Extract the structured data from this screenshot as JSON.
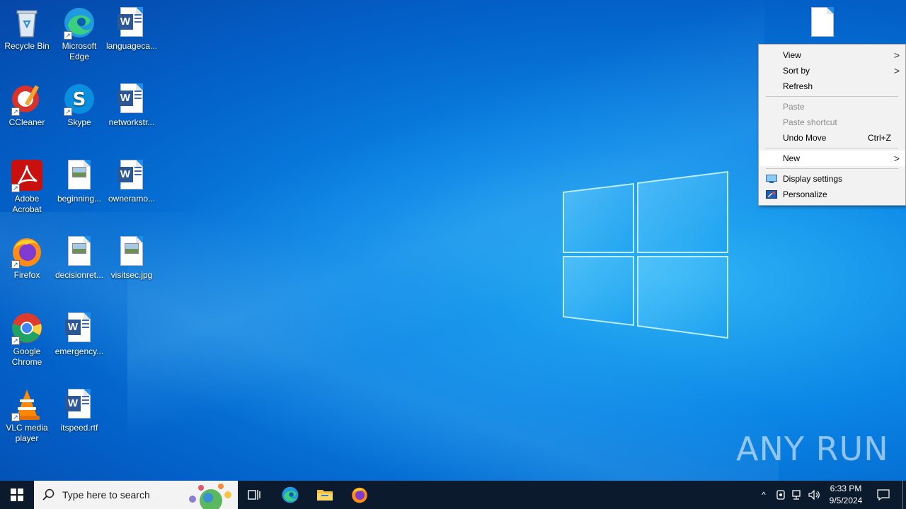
{
  "desktop": {
    "icons": [
      {
        "label": "Recycle Bin",
        "icon": "recycle-bin-icon"
      },
      {
        "label": "Microsoft Edge",
        "icon": "edge-icon"
      },
      {
        "label": "languageca...",
        "icon": "word-doc-icon"
      },
      {
        "label": "CCleaner",
        "icon": "ccleaner-icon"
      },
      {
        "label": "Skype",
        "icon": "skype-icon"
      },
      {
        "label": "networkstr...",
        "icon": "word-doc-icon"
      },
      {
        "label": "Adobe Acrobat",
        "icon": "acrobat-icon"
      },
      {
        "label": "beginning...",
        "icon": "image-file-icon"
      },
      {
        "label": "owneramo...",
        "icon": "word-doc-icon"
      },
      {
        "label": "Firefox",
        "icon": "firefox-icon"
      },
      {
        "label": "decisionret...",
        "icon": "image-file-icon"
      },
      {
        "label": "visitsec.jpg",
        "icon": "image-file-icon"
      },
      {
        "label": "Google Chrome",
        "icon": "chrome-icon"
      },
      {
        "label": "emergency...",
        "icon": "word-doc-icon"
      },
      {
        "label": "VLC media player",
        "icon": "vlc-icon"
      },
      {
        "label": "itspeed.rtf",
        "icon": "word-doc-icon"
      },
      {
        "label": "",
        "icon": "blank-file-icon"
      }
    ]
  },
  "context_menu": {
    "items": [
      {
        "label": "View",
        "submenu": true
      },
      {
        "label": "Sort by",
        "submenu": true
      },
      {
        "label": "Refresh"
      },
      {
        "label": "Paste",
        "disabled": true
      },
      {
        "label": "Paste shortcut",
        "disabled": true
      },
      {
        "label": "Undo Move",
        "accel": "Ctrl+Z"
      },
      {
        "label": "New",
        "submenu": true
      },
      {
        "label": "Display settings",
        "icon": "display-icon"
      },
      {
        "label": "Personalize",
        "icon": "personalize-icon"
      }
    ]
  },
  "taskbar": {
    "search_placeholder": "Type here to search",
    "time": "6:33 PM",
    "date": "9/5/2024",
    "pinned": [
      "task-view-icon",
      "edge-icon",
      "file-explorer-icon",
      "firefox-icon"
    ]
  },
  "watermark": "ANY RUN",
  "colors": {
    "accent": "#0078d7",
    "taskbar": "#0c1a2e",
    "menu_bg": "#f2f2f2"
  }
}
